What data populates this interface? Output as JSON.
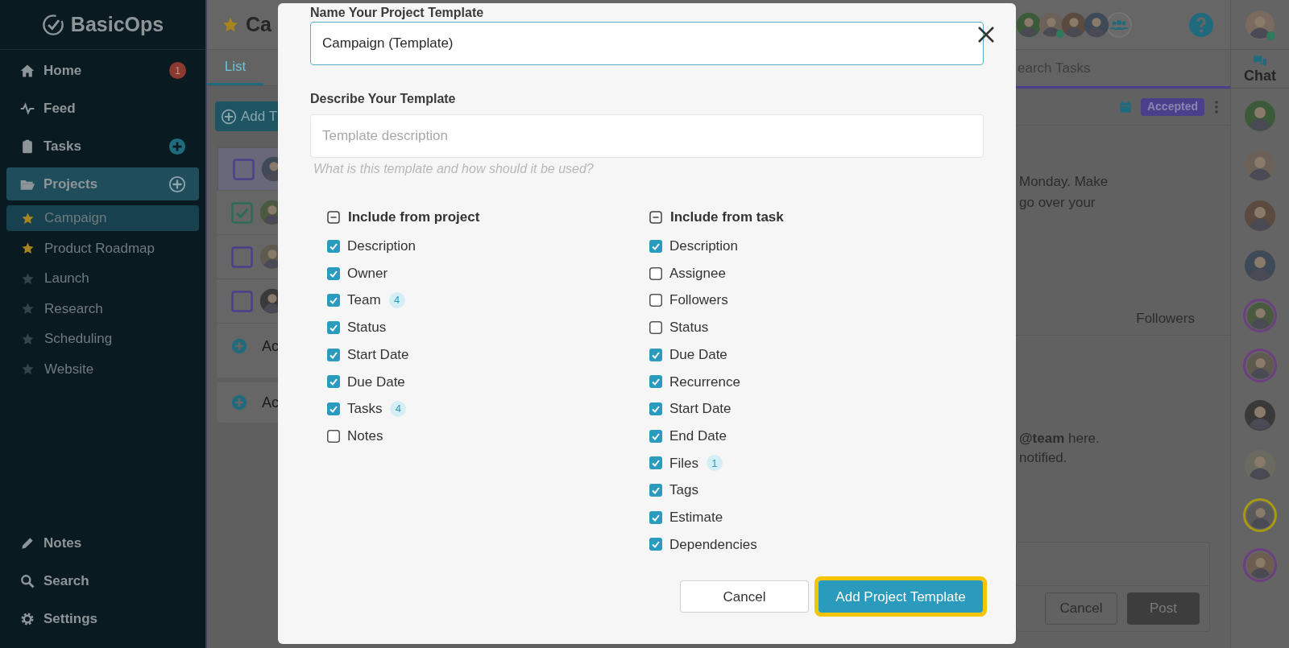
{
  "sidebar": {
    "logo": "BasicOps",
    "nav": [
      {
        "label": "Home",
        "badge": "1",
        "add": false,
        "selected": false
      },
      {
        "label": "Feed",
        "add": false,
        "selected": false
      },
      {
        "label": "Tasks",
        "add": true,
        "selected": false
      },
      {
        "label": "Projects",
        "add": true,
        "selected": true
      }
    ],
    "projects": [
      {
        "label": "Campaign",
        "starred": true,
        "selected": true
      },
      {
        "label": "Product Roadmap",
        "starred": true,
        "selected": false
      },
      {
        "label": "Launch",
        "starred": false,
        "selected": false
      },
      {
        "label": "Research",
        "starred": false,
        "selected": false
      },
      {
        "label": "Scheduling",
        "starred": false,
        "selected": false
      },
      {
        "label": "Website",
        "starred": false,
        "selected": false
      }
    ],
    "bottom": [
      {
        "label": "Notes"
      },
      {
        "label": "Search"
      },
      {
        "label": "Settings"
      }
    ]
  },
  "header": {
    "title": "Ca",
    "members": [
      {
        "online": false
      },
      {
        "online": true
      },
      {
        "online": false
      },
      {
        "online": false
      }
    ],
    "user": {
      "online": true
    }
  },
  "tabs": [
    {
      "label": "List",
      "selected": true
    }
  ],
  "search": {
    "placeholder": "earch Tasks"
  },
  "task_list": {
    "add_button": "Add T",
    "rows": [
      {
        "checked": false,
        "selected": true
      },
      {
        "checked": true,
        "selected": false
      },
      {
        "checked": false,
        "selected": false
      },
      {
        "checked": false,
        "selected": false
      }
    ],
    "add_rows": [
      "Ac",
      "Ac"
    ]
  },
  "detail": {
    "status": "Accepted",
    "text_lines": [
      "Monday. Make",
      "go over your"
    ],
    "followers_label": "Followers",
    "hint_lines": [
      "**@team** here.",
      "notified."
    ],
    "buttons": [
      {
        "label": "Cancel",
        "kind": "secondary"
      },
      {
        "label": "Post",
        "kind": "primary"
      }
    ]
  },
  "chat": {
    "label": "Chat",
    "avatars": [
      {
        "ring": false
      },
      {
        "ring": false
      },
      {
        "ring": false
      },
      {
        "ring": false
      },
      {
        "ring": true,
        "color": "#6b3f80"
      },
      {
        "ring": true,
        "color": "#6b3f80"
      },
      {
        "ring": false
      },
      {
        "ring": false
      },
      {
        "ring": true,
        "color": "#a89a10"
      },
      {
        "ring": true,
        "color": "#6b3f80"
      }
    ]
  },
  "modal": {
    "name_label": "Name Your Project Template",
    "name_value": "Campaign (Template)",
    "desc_label": "Describe Your Template",
    "desc_placeholder": "Template description",
    "desc_hint": "What is this template and how should it be used?",
    "columns": [
      {
        "title": "Include from project",
        "items": [
          {
            "label": "Description",
            "checked": true
          },
          {
            "label": "Owner",
            "checked": true
          },
          {
            "label": "Team",
            "checked": true,
            "count": "4"
          },
          {
            "label": "Status",
            "checked": true
          },
          {
            "label": "Start Date",
            "checked": true
          },
          {
            "label": "Due Date",
            "checked": true
          },
          {
            "label": "Tasks",
            "checked": true,
            "count": "4"
          },
          {
            "label": "Notes",
            "checked": false
          }
        ]
      },
      {
        "title": "Include from task",
        "items": [
          {
            "label": "Description",
            "checked": true
          },
          {
            "label": "Assignee",
            "checked": false
          },
          {
            "label": "Followers",
            "checked": false
          },
          {
            "label": "Status",
            "checked": false
          },
          {
            "label": "Due Date",
            "checked": true
          },
          {
            "label": "Recurrence",
            "checked": true
          },
          {
            "label": "Start Date",
            "checked": true
          },
          {
            "label": "End Date",
            "checked": true
          },
          {
            "label": "Files",
            "checked": true,
            "count": "1"
          },
          {
            "label": "Tags",
            "checked": true
          },
          {
            "label": "Estimate",
            "checked": true
          },
          {
            "label": "Dependencies",
            "checked": true
          }
        ]
      }
    ],
    "buttons": [
      {
        "label": "Cancel",
        "kind": "secondary",
        "highlighted": false
      },
      {
        "label": "Add Project Template",
        "kind": "primary",
        "highlighted": true
      }
    ]
  }
}
